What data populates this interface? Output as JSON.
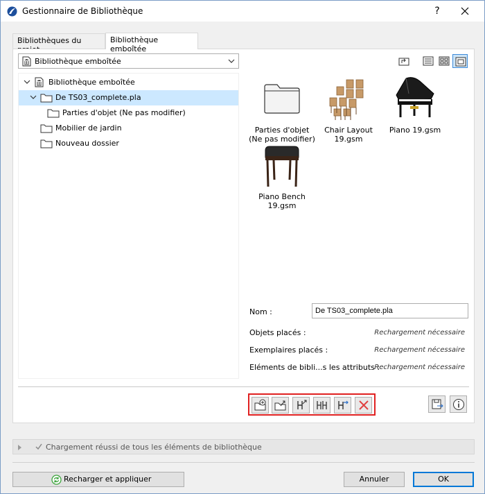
{
  "window": {
    "title": "Gestionnaire de Bibliothèque",
    "help": "?",
    "close": "✕"
  },
  "tabs": [
    {
      "label": "Bibliothèques du projet",
      "active": false
    },
    {
      "label": "Bibliothèque emboîtée",
      "active": true
    }
  ],
  "library_select": {
    "value": "Bibliothèque emboîtée"
  },
  "tree": [
    {
      "label": "Bibliothèque emboîtée",
      "expanded": true,
      "icon": "library-icon"
    },
    {
      "label": "De TS03_complete.pla",
      "expanded": true,
      "selected": true,
      "icon": "folder-icon"
    },
    {
      "label": "Parties d'objet (Ne pas modifier)",
      "icon": "folder-icon"
    },
    {
      "label": "Mobilier de jardin",
      "icon": "folder-icon"
    },
    {
      "label": "Nouveau dossier",
      "icon": "folder-icon"
    }
  ],
  "tiles": [
    {
      "label": "Parties d'objet\n(Ne pas modifier)",
      "icon": "folder-icon"
    },
    {
      "label": "Chair Layout\n19.gsm",
      "icon": "chair-layout-icon"
    },
    {
      "label": "Piano 19.gsm",
      "icon": "piano-icon"
    },
    {
      "label": "Piano Bench\n19.gsm",
      "icon": "piano-bench-icon"
    }
  ],
  "info": {
    "name_label": "Nom :",
    "name_value": "De TS03_complete.pla",
    "rows": [
      {
        "label": "Objets placés :",
        "value": "Rechargement nécessaire"
      },
      {
        "label": "Exemplaires placés :",
        "value": "Rechargement nécessaire"
      },
      {
        "label": "Eléments de bibli...s les attributs :",
        "value": "Rechargement nécessaire"
      }
    ]
  },
  "status": {
    "message": "Chargement réussi de tous les éléments de bibliothèque"
  },
  "buttons": {
    "reload": "Recharger et appliquer",
    "cancel": "Annuler",
    "ok": "OK"
  },
  "colors": {
    "accent": "#0078d7",
    "selection": "#cce8ff",
    "highlight_border": "#e02020",
    "delete_red": "#e04040"
  }
}
